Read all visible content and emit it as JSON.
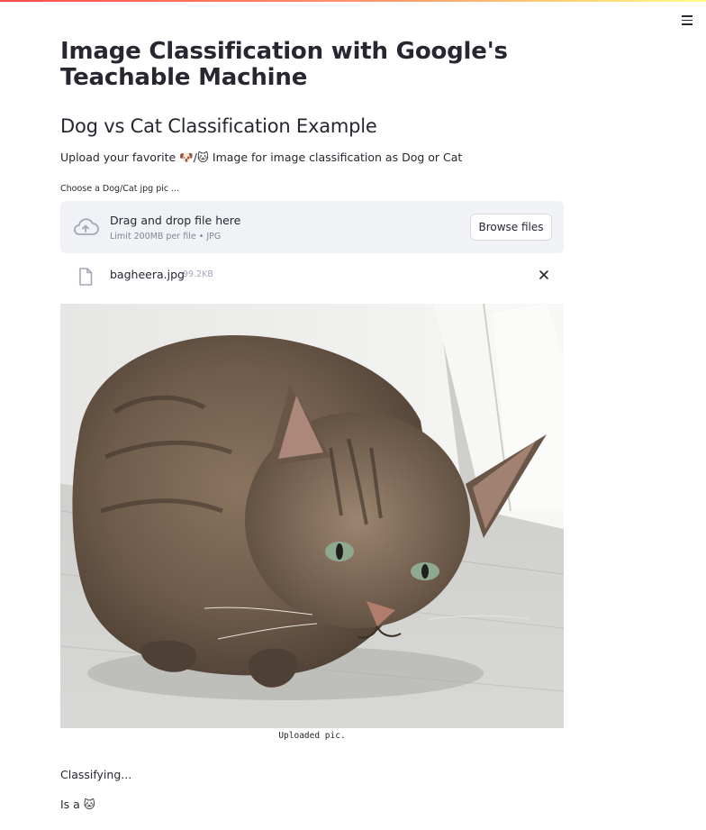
{
  "app": {
    "title": "Image Classification with Google's Teachable Machine",
    "menu_icon": "hamburger-menu-icon"
  },
  "content": {
    "subtitle": "Dog vs Cat Classification Example",
    "intro": "Upload your favorite 🐶/🐱 Image for image classification as Dog or Cat"
  },
  "uploader": {
    "label": "Choose a Dog/Cat jpg pic ...",
    "drop_title": "Drag and drop file here",
    "drop_limit": "Limit 200MB per file • JPG",
    "browse_label": "Browse files",
    "upload_icon": "cloud-upload-icon"
  },
  "uploaded_file": {
    "name": "bagheera.jpg",
    "size": "99.2KB",
    "file_icon": "file-icon",
    "remove_icon": "close-icon"
  },
  "image": {
    "caption": "Uploaded pic."
  },
  "status": {
    "classifying": "Classifying...",
    "result": "Is a 🐱"
  },
  "colors": {
    "accent": "#ff4b4b",
    "text": "#262730",
    "dropzone_bg": "#f0f2f6",
    "muted": "#818494"
  }
}
